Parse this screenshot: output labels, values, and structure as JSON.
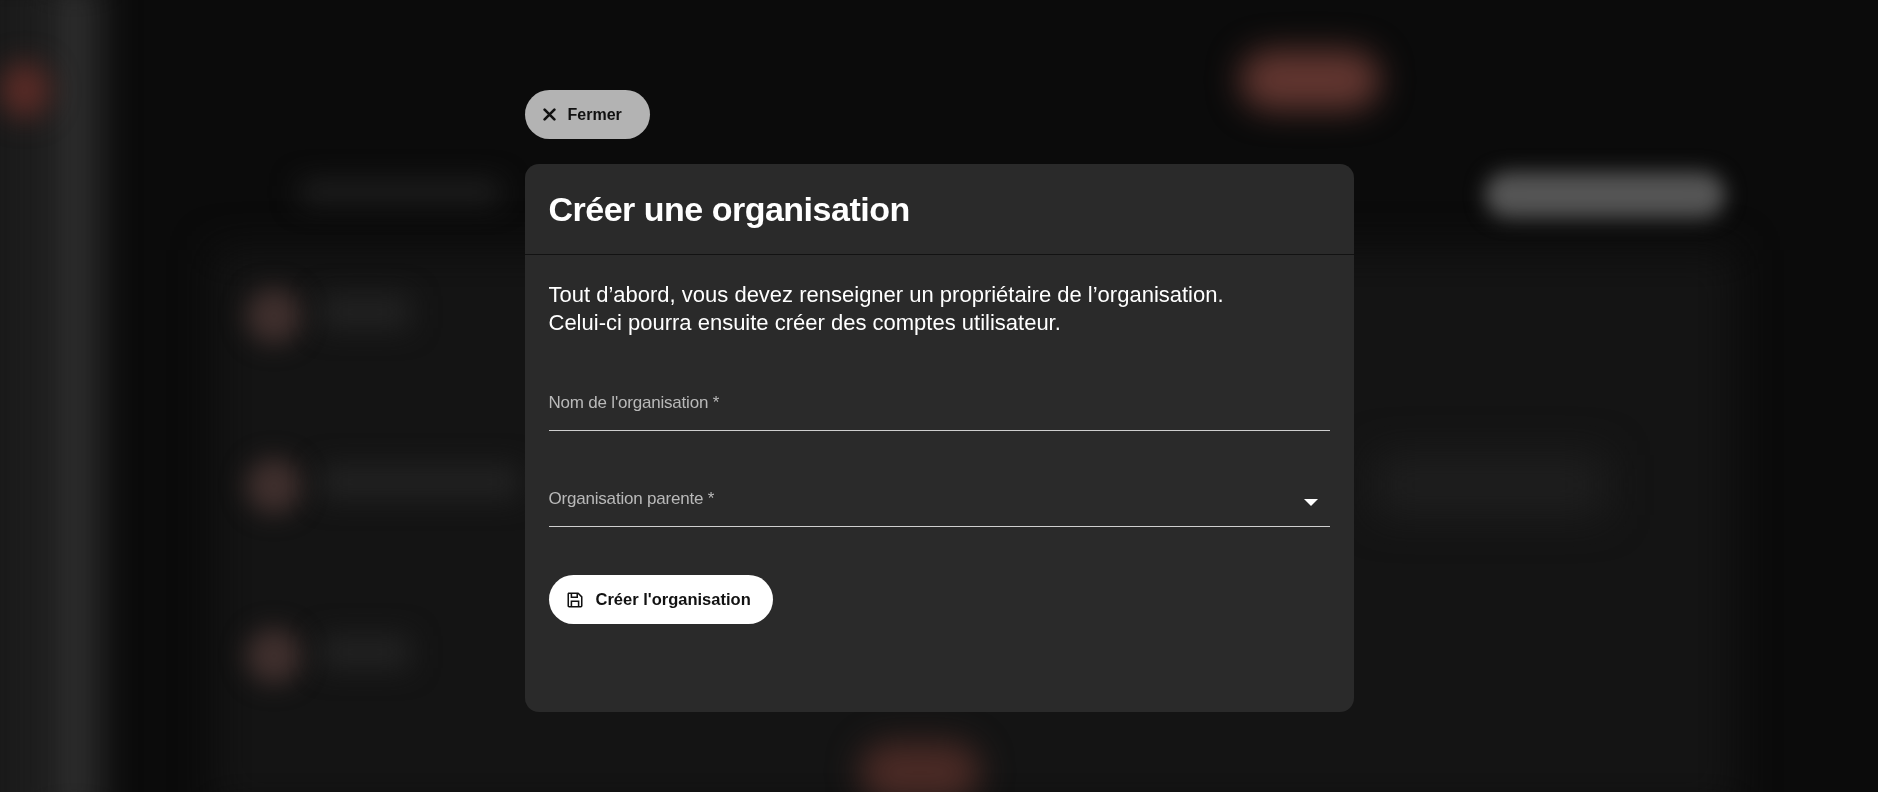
{
  "close_button": {
    "label": "Fermer"
  },
  "dialog": {
    "title": "Créer une organisation",
    "intro": "Tout d’abord, vous devez renseigner un propriétaire de l’organisation.\nCelui-ci pourra ensuite créer des comptes utilisateur.",
    "fields": [
      {
        "kind": "text",
        "label": "Nom de l'organisation *"
      },
      {
        "kind": "select",
        "label": "Organisation parente *"
      }
    ],
    "submit_button": {
      "label": "Créer l'organisation"
    }
  }
}
